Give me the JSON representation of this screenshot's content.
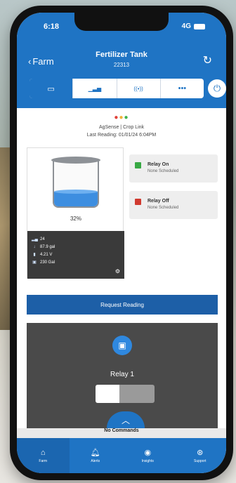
{
  "status_bar": {
    "time": "6:18",
    "network": "4G"
  },
  "header": {
    "back_label": "Farm",
    "title": "Fertilizer Tank",
    "subtitle": "22313"
  },
  "tabs": [
    {
      "name": "overview",
      "icon": "toggle-icon",
      "glyph": "▭"
    },
    {
      "name": "chart",
      "icon": "chart-icon",
      "glyph": "▁▃▅"
    },
    {
      "name": "signal",
      "icon": "signal-icon",
      "glyph": "((•))"
    },
    {
      "name": "more",
      "icon": "more-icon",
      "glyph": "•••"
    }
  ],
  "device": {
    "status_dots": [
      "#e0403a",
      "#f2b23a",
      "#3fb34f"
    ],
    "source": "AgSense | Crop Link",
    "last_reading": "Last Reading: 01/01/24 6:04PM"
  },
  "tank": {
    "level_fraction": 0.32,
    "percent_label": "32%",
    "readings": [
      {
        "icon": "chart-icon",
        "glyph": "▂▄",
        "value": "24"
      },
      {
        "icon": "fill-icon",
        "glyph": "↓",
        "value": "87.9 gal"
      },
      {
        "icon": "battery-icon",
        "glyph": "▮",
        "value": "4.21 V"
      },
      {
        "icon": "tank-icon",
        "glyph": "▣",
        "value": "230 Gal"
      }
    ]
  },
  "relays": [
    {
      "label": "Relay On",
      "schedule": "None Scheduled",
      "color": "#38a844"
    },
    {
      "label": "Relay Off",
      "schedule": "None Scheduled",
      "color": "#d03a2f"
    }
  ],
  "request_button": "Request Reading",
  "relay_panel": {
    "label": "Relay 1",
    "state": "on"
  },
  "commands_status": "No Commands",
  "bottom_nav": [
    {
      "label": "Farm",
      "icon": "farm-icon",
      "glyph": "⌂"
    },
    {
      "label": "Alerts",
      "icon": "bell-icon",
      "glyph": "🔔︎"
    },
    {
      "label": "Insights",
      "icon": "eye-icon",
      "glyph": "◉"
    },
    {
      "label": "Support",
      "icon": "lifebuoy-icon",
      "glyph": "⊛"
    }
  ]
}
